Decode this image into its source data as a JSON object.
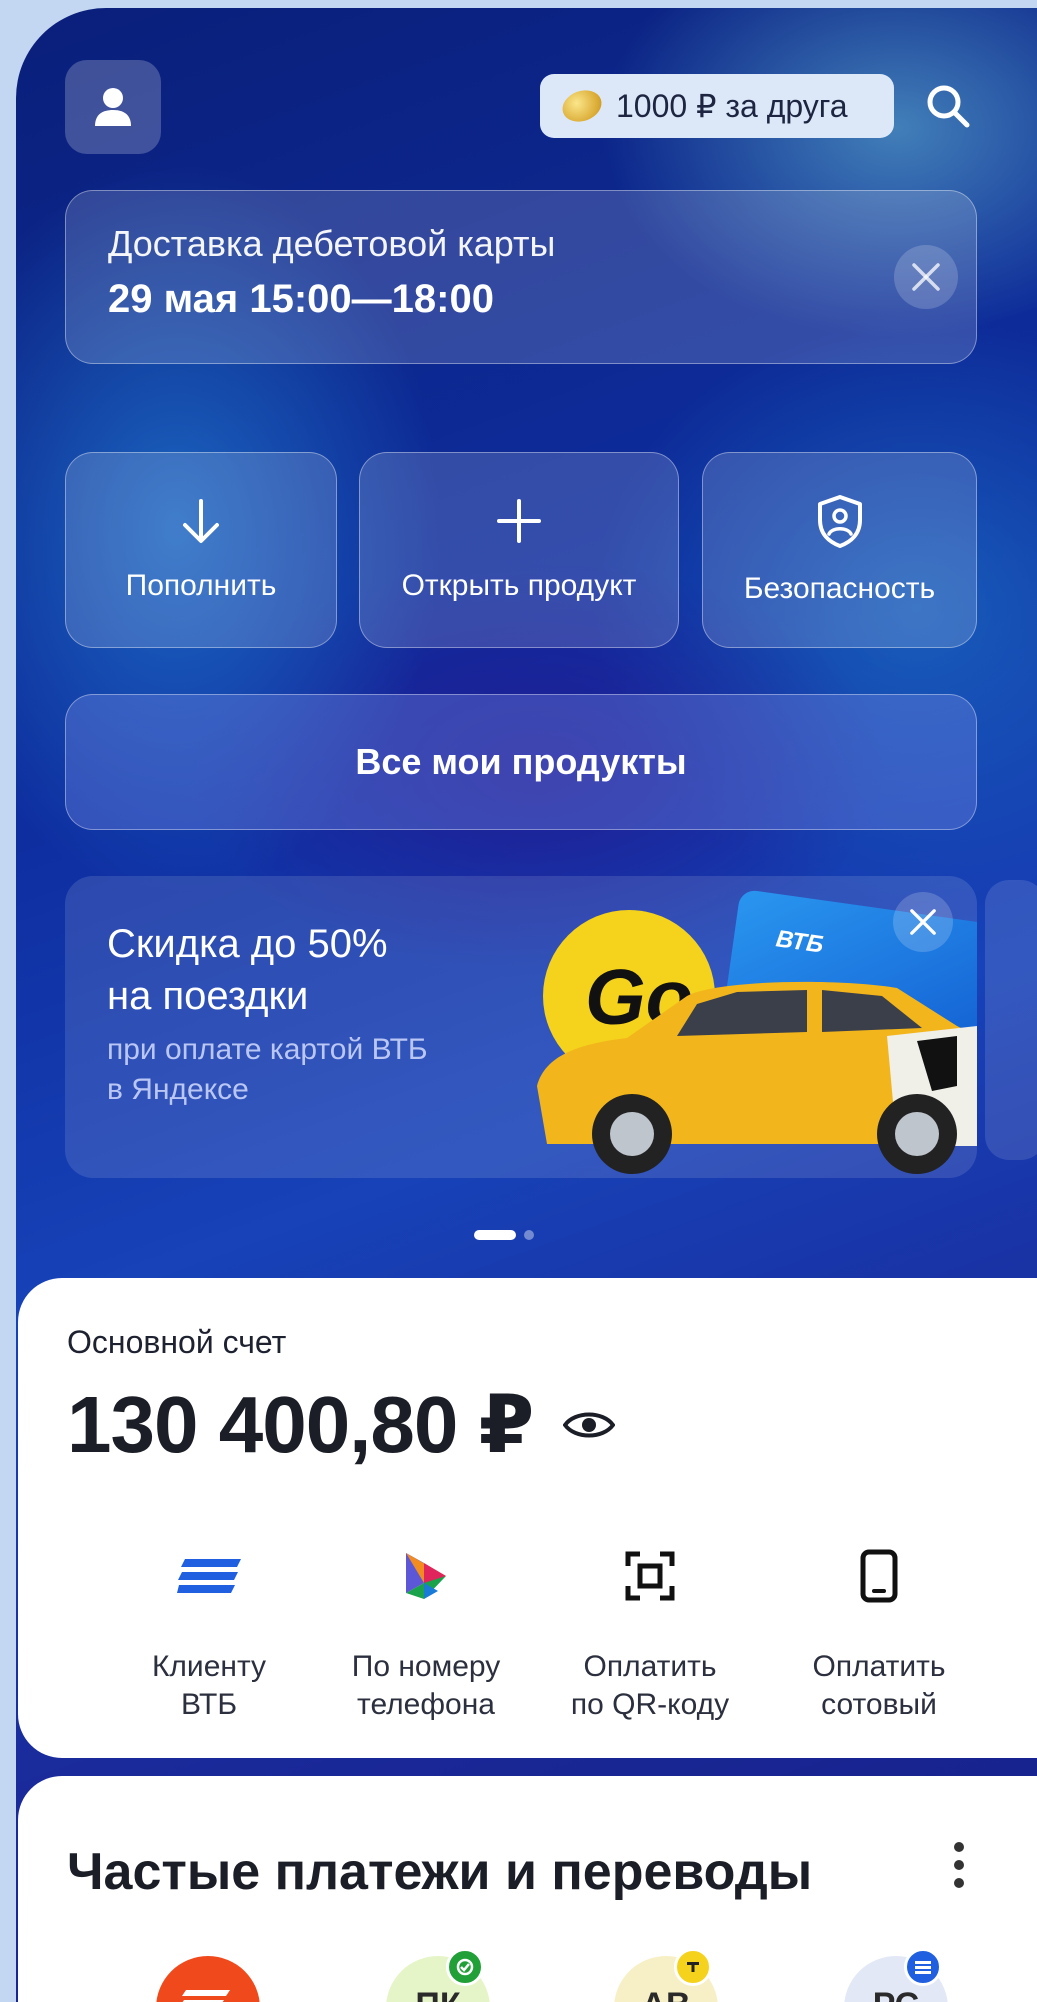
{
  "header": {
    "referral_label": "1000 ₽ за друга",
    "avatar_icon": "user-icon",
    "search_icon": "search-icon"
  },
  "delivery": {
    "title": "Доставка дебетовой карты",
    "time": "29 мая 15:00—18:00"
  },
  "actions": [
    {
      "label": "Пополнить",
      "icon": "arrow-down-icon"
    },
    {
      "label": "Открыть продукт",
      "icon": "plus-icon"
    },
    {
      "label": "Безопасность",
      "icon": "shield-icon"
    }
  ],
  "all_products_label": "Все мои продукты",
  "promo": {
    "title_line1": "Скидка до 50%",
    "title_line2": "на поездки",
    "subtitle_line1": "при оплате картой ВТБ",
    "subtitle_line2": "в Яндексе",
    "card_brand": "ВТБ",
    "go_text": "Go"
  },
  "account": {
    "label": "Основной счет",
    "amount": "130 400,80 ₽"
  },
  "quick_actions": [
    {
      "line1": "Клиенту",
      "line2": "ВТБ",
      "icon": "vtb-icon"
    },
    {
      "line1": "По номеру",
      "line2": "телефона",
      "icon": "sbp-icon"
    },
    {
      "line1": "Оплатить",
      "line2": "по QR-коду",
      "icon": "qr-scan-icon"
    },
    {
      "line1": "Оплатить",
      "line2": "сотовый",
      "icon": "phone-icon"
    }
  ],
  "frequent": {
    "title": "Частые платежи и переводы",
    "items": [
      {
        "initials": "",
        "color": "#f04a1c"
      },
      {
        "initials": "ПК",
        "color": "#e6f5c8"
      },
      {
        "initials": "АВ",
        "color": "#f7f0c6"
      },
      {
        "initials": "РС",
        "color": "#e2e8f6"
      }
    ]
  },
  "colors": {
    "accent_blue": "#1f5fe0",
    "background": "#c3d6f2"
  }
}
